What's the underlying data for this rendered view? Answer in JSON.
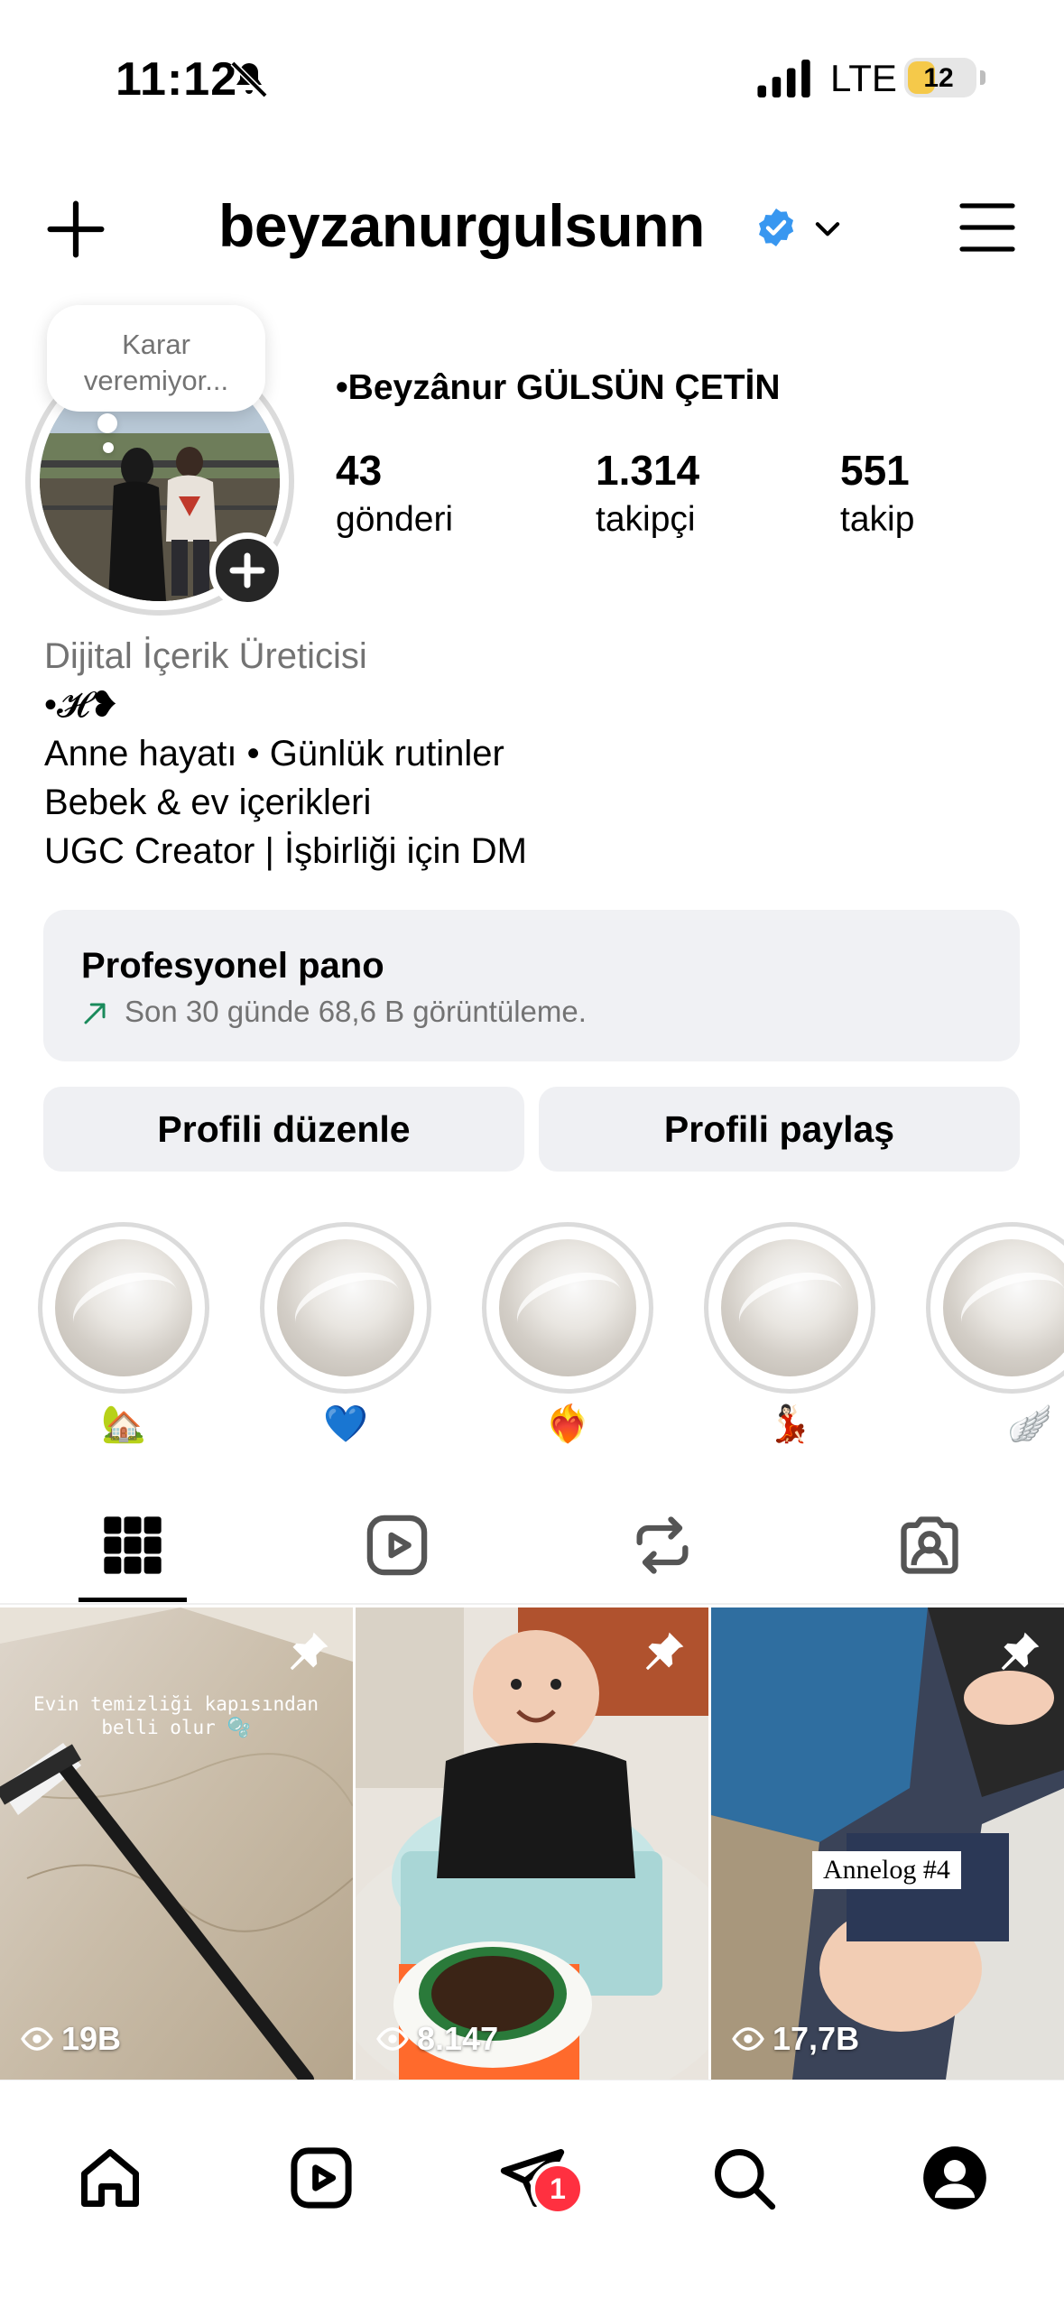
{
  "status_bar": {
    "time": "11:12",
    "network": "LTE",
    "battery": "12"
  },
  "header": {
    "username": "beyzanurgulsunn"
  },
  "profile": {
    "note": "Karar veremiyor...",
    "full_name": "•Beyzânur GÜLSÜN ÇETİN",
    "stats": [
      {
        "value": "43",
        "label": "gönderi"
      },
      {
        "value": "1.314",
        "label": "takipçi"
      },
      {
        "value": "551",
        "label": "takip"
      }
    ],
    "category": "Dijital İçerik Üreticisi",
    "bio_lines": [
      "•𝓗❥",
      "Anne hayatı • Günlük rutinler",
      "Bebek & ev içerikleri",
      "UGC Creator | İşbirliği için DM"
    ]
  },
  "dashboard": {
    "title": "Profesyonel pano",
    "subtitle": "Son 30 günde 68,6 B görüntüleme."
  },
  "buttons": {
    "edit": "Profili düzenle",
    "share": "Profili paylaş"
  },
  "highlights": [
    {
      "label": "🏡"
    },
    {
      "label": "💙"
    },
    {
      "label": "❤️‍🔥"
    },
    {
      "label": "💃🏻"
    },
    {
      "label": "🪽"
    }
  ],
  "posts": [
    {
      "views": "19B",
      "overlay": "Evin temizliği kapısından belli olur 🫧",
      "pinned": true
    },
    {
      "views": "8.147",
      "pinned": true
    },
    {
      "views": "17,7B",
      "overlay": "Annelog #4",
      "pinned": true
    }
  ],
  "nav": {
    "messages_badge": "1"
  }
}
